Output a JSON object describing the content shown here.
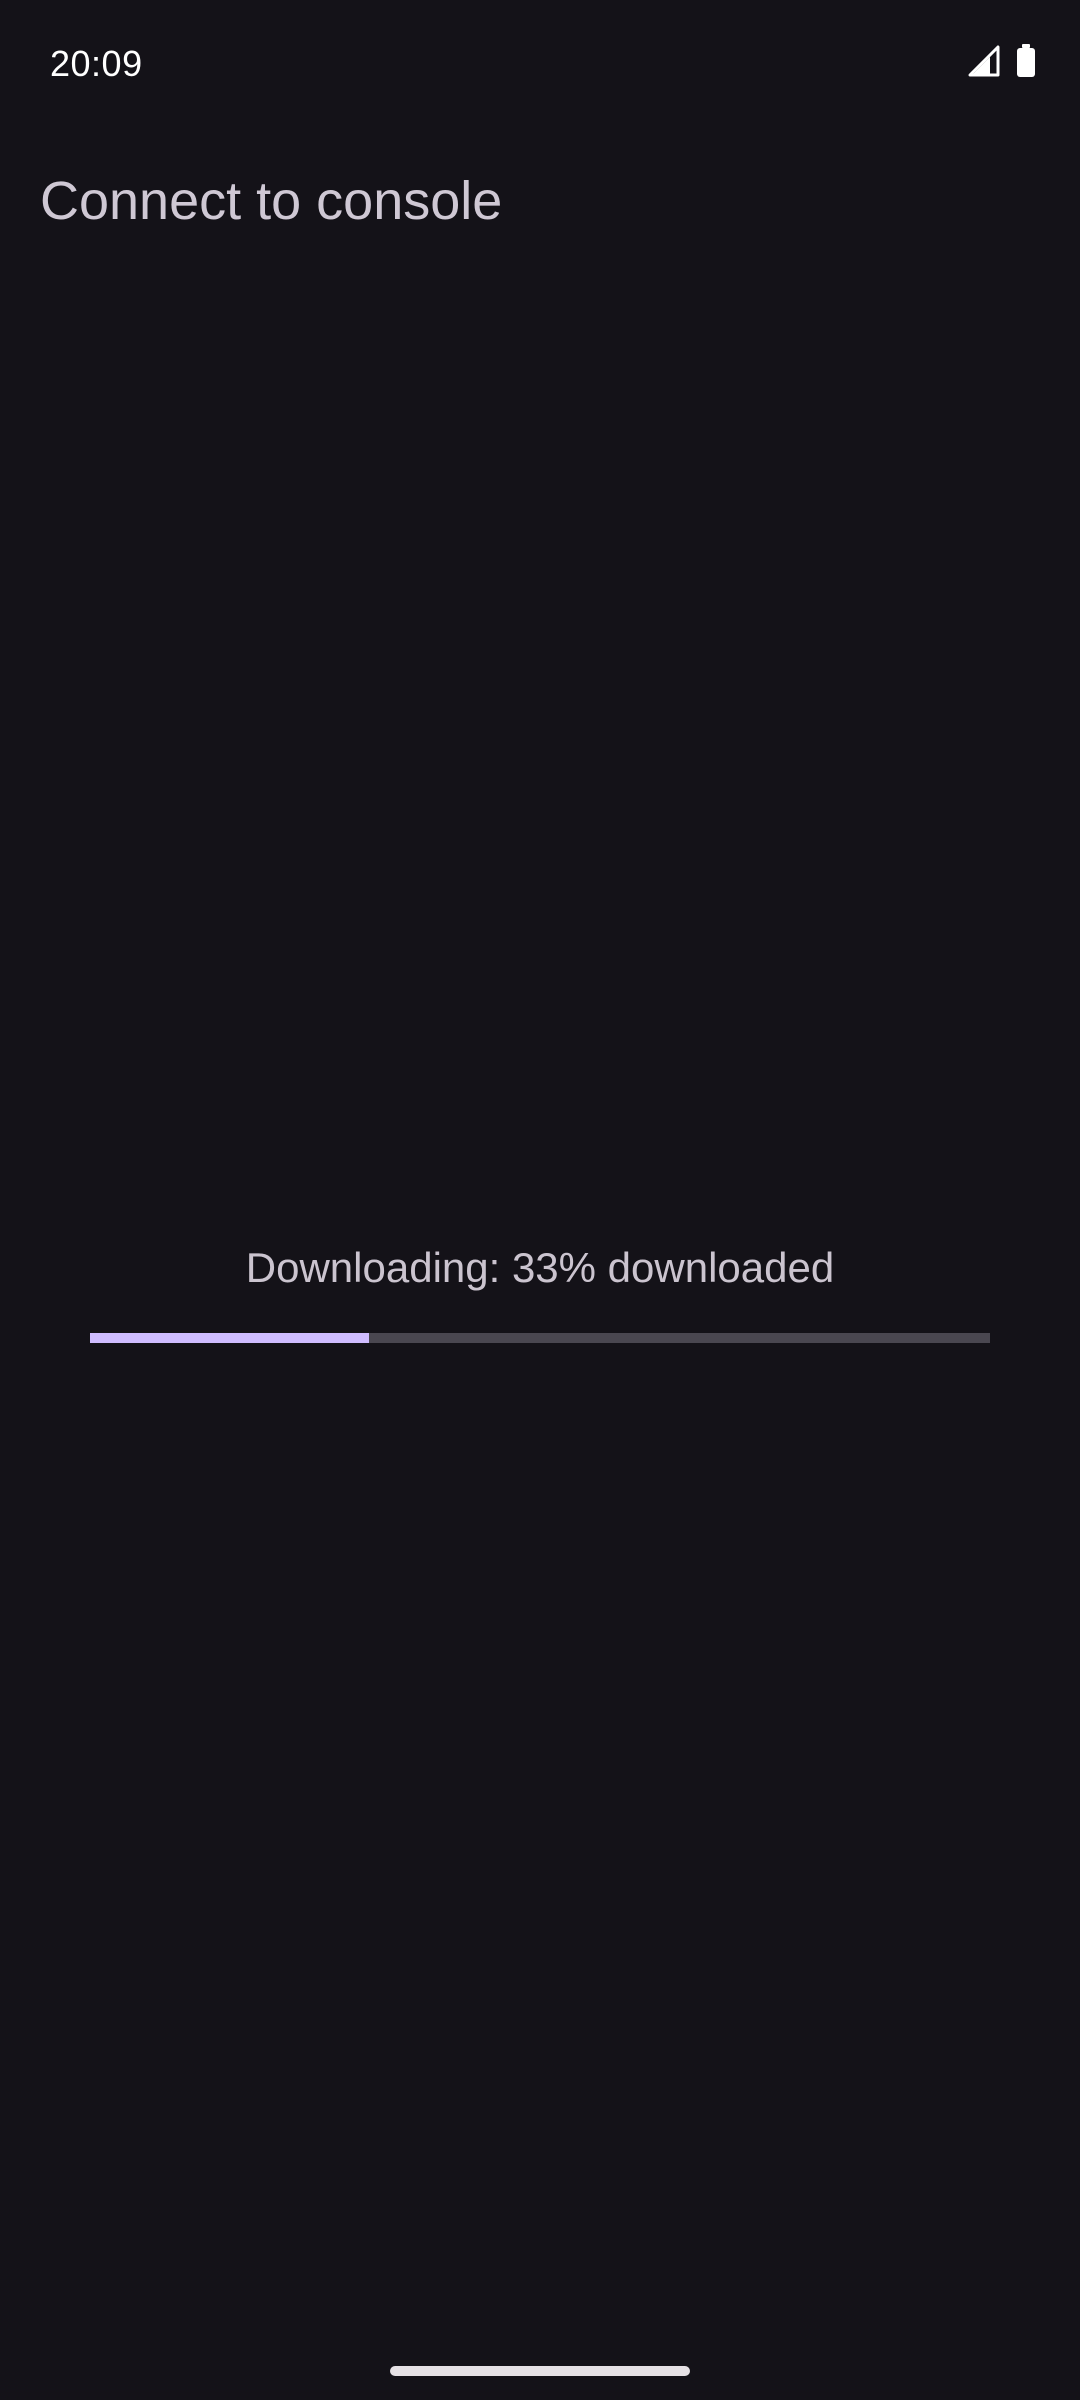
{
  "status_bar": {
    "time": "20:09",
    "icons": [
      "cellular-signal-icon",
      "battery-icon"
    ]
  },
  "header": {
    "title": "Connect to console"
  },
  "download": {
    "status_text": "Downloading: 33% downloaded",
    "progress_fraction": 0.31
  },
  "colors": {
    "background": "#141218",
    "progress_fill": "#d0bcff",
    "progress_track": "#4a4750",
    "text": "#cbc4cf"
  }
}
